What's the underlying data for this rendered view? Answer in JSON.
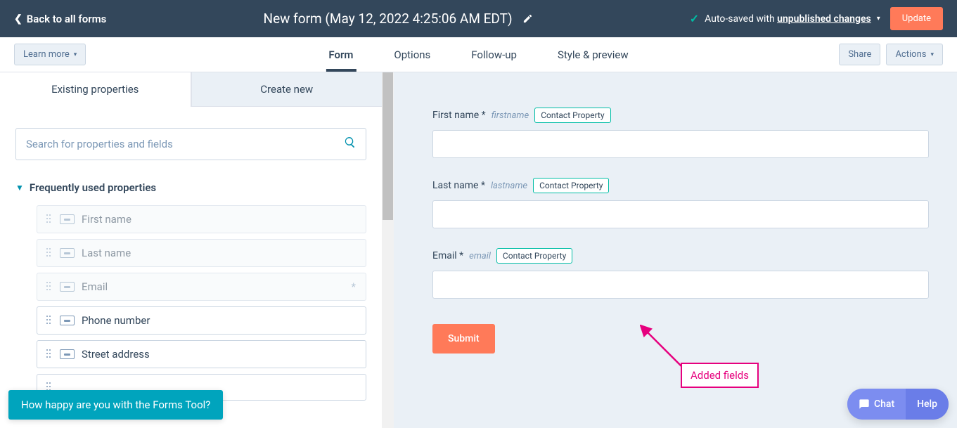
{
  "topbar": {
    "back_label": "Back to all forms",
    "form_title": "New form (May 12, 2022 4:25:06 AM EDT)",
    "autosave_prefix": "Auto-saved with ",
    "autosave_link": "unpublished changes",
    "update_label": "Update"
  },
  "secondbar": {
    "learn_more": "Learn more",
    "tabs": [
      "Form",
      "Options",
      "Follow-up",
      "Style & preview"
    ],
    "share": "Share",
    "actions": "Actions"
  },
  "left": {
    "tabs": [
      "Existing properties",
      "Create new"
    ],
    "search_placeholder": "Search for properties and fields",
    "section_title": "Frequently used properties",
    "properties": [
      {
        "label": "First name",
        "disabled": true,
        "asterisk": false
      },
      {
        "label": "Last name",
        "disabled": true,
        "asterisk": false
      },
      {
        "label": "Email",
        "disabled": true,
        "asterisk": true
      },
      {
        "label": "Phone number",
        "disabled": false,
        "asterisk": false
      },
      {
        "label": "Street address",
        "disabled": false,
        "asterisk": false
      }
    ]
  },
  "preview": {
    "fields": [
      {
        "label": "First name *",
        "internal": "firstname",
        "badge": "Contact Property"
      },
      {
        "label": "Last name *",
        "internal": "lastname",
        "badge": "Contact Property"
      },
      {
        "label": "Email *",
        "internal": "email",
        "badge": "Contact Property"
      }
    ],
    "submit_label": "Submit"
  },
  "annotation": {
    "label": "Added fields"
  },
  "widgets": {
    "chat": "Chat",
    "help": "Help",
    "survey": "How happy are you with the Forms Tool?"
  }
}
